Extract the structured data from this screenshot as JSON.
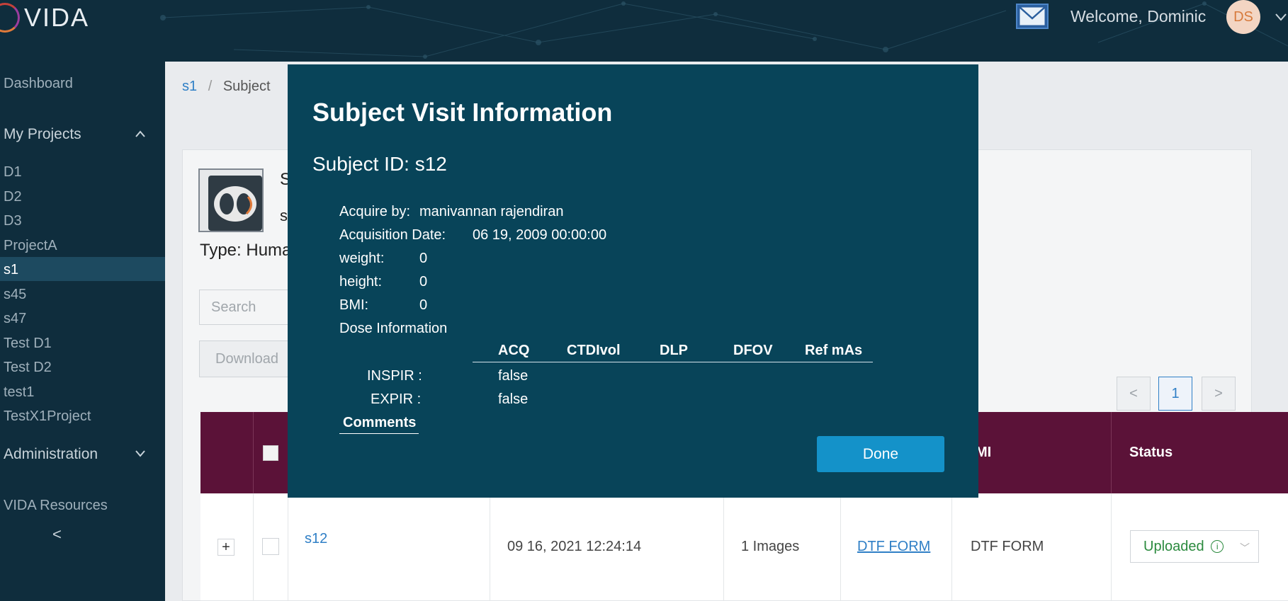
{
  "header": {
    "logo_text": "VIDA",
    "welcome_text": "Welcome, Dominic",
    "avatar_initials": "DS",
    "mail_icon": "mail-icon"
  },
  "sidebar": {
    "dashboard": "Dashboard",
    "my_projects": "My Projects",
    "projects": [
      "D1",
      "D2",
      "D3",
      "ProjectA",
      "s1",
      "s45",
      "s47",
      "Test D1",
      "Test D2",
      "test1",
      "TestX1Project"
    ],
    "selected_project": "s1",
    "administration": "Administration",
    "resources": "VIDA Resources",
    "collapse_glyph": "<"
  },
  "breadcrumb": {
    "project": "s1",
    "separator": "/",
    "current": "Subject"
  },
  "subject_card": {
    "title_partial": "S",
    "second_line_partial": "s",
    "type_partial": "Type: Huma",
    "search_placeholder": "Search",
    "download_partial": "Download",
    "page_prev": "<",
    "page_current": "1",
    "page_next": ">"
  },
  "table": {
    "headers_visible": [
      "MI",
      "Status"
    ],
    "row": {
      "expand": "+",
      "subject_id": "s12",
      "date": "09 16, 2021 12:24:14",
      "images": "1 Images",
      "form_link": "DTF FORM",
      "form_text": "DTF FORM",
      "status": "Uploaded",
      "status_info": "i",
      "status_color": "#2b8a3e"
    }
  },
  "modal": {
    "title": "Subject Visit Information",
    "subject_id_label": "Subject ID: s12",
    "acquire_label": "Acquire by:",
    "acquire_value": "manivannan rajendiran",
    "acq_date_label": "Acquisition Date:",
    "acq_date_value": "06 19, 2009 00:00:00",
    "weight_label": "weight:",
    "weight_value": "0",
    "height_label": "height:",
    "height_value": "0",
    "bmi_label": "BMI:",
    "bmi_value": "0",
    "dose_label": "Dose Information",
    "dose_columns": [
      "ACQ",
      "CTDIvol",
      "DLP",
      "DFOV",
      "Ref mAs"
    ],
    "dose_rows": [
      {
        "label": "INSPIR :",
        "acq": "false"
      },
      {
        "label": "EXPIR :",
        "acq": "false"
      }
    ],
    "comments_label": "Comments",
    "done_label": "Done",
    "background_color": "#084459",
    "button_color": "#1492c9"
  },
  "colors": {
    "nav_bg": "#0f2d3d",
    "table_header_bg": "#5b1238",
    "link": "#2f7fc6"
  }
}
